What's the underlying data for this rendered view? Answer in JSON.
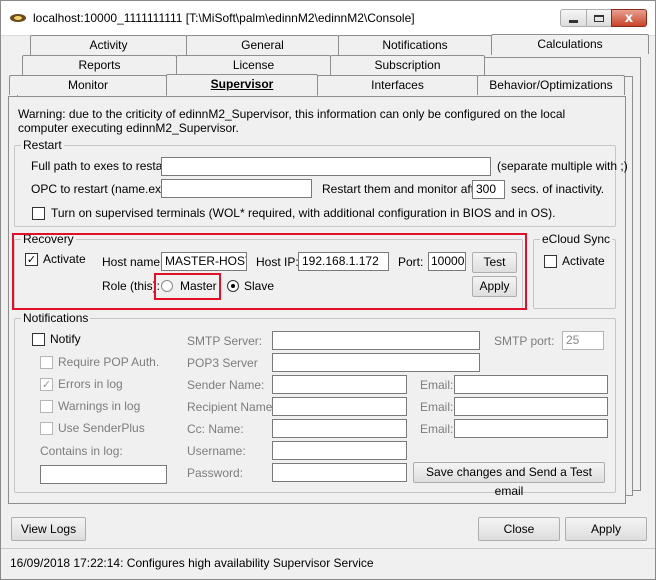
{
  "window": {
    "title": "localhost:10000_1111111111 [T:\\MiSoft\\palm\\edinnM2\\edinnM2\\Console]",
    "close_glyph": "x",
    "icons": [
      "app-icon",
      "minimize-icon",
      "maximize-icon",
      "close-icon"
    ]
  },
  "tabs": {
    "row1": [
      "Activity",
      "General",
      "Notifications",
      "Calculations"
    ],
    "row2": [
      "Reports",
      "License",
      "Subscription"
    ],
    "row3": [
      "Monitor",
      "Supervisor",
      "Interfaces",
      "Behavior/Optimizations"
    ],
    "active": "Supervisor"
  },
  "warning": "Warning: due to the criticity of edinnM2_Supervisor, this information can only be configured on the local computer executing edinnM2_Supervisor.",
  "restart": {
    "legend": "Restart",
    "exes_label": "Full path to exes to restart:",
    "exes_value": "",
    "exes_hint": "(separate multiple with ;)",
    "opc_label": "OPC to restart (name.exe):",
    "opc_value": "",
    "monitor_label": "Restart them and monitor after:",
    "monitor_value": "300",
    "monitor_suffix": "secs. of inactivity.",
    "wol_label": "Turn on supervised terminals (WOL* required, with additional configuration in BIOS and in OS).",
    "wol_checked": false
  },
  "recovery": {
    "legend": "Recovery",
    "activate_label": "Activate",
    "activate_checked": true,
    "check_glyph": "✓",
    "host_name_label": "Host name:",
    "host_name_value": "MASTER-HOST",
    "host_ip_label": "Host IP:",
    "host_ip_value": "192.168.1.172",
    "port_label": "Port:",
    "port_value": "10000",
    "test_label": "Test",
    "role_label": "Role (this):",
    "master_label": "Master",
    "slave_label": "Slave",
    "selected_role": "Slave",
    "apply_label": "Apply"
  },
  "ecloud": {
    "legend": "eCloud Sync",
    "activate_label": "Activate",
    "activate_checked": false
  },
  "notifications": {
    "legend": "Notifications",
    "notify_label": "Notify",
    "notify_checked": false,
    "require_pop_label": "Require POP Auth.",
    "errors_label": "Errors in log",
    "errors_checked": true,
    "warnings_label": "Warnings in log",
    "sender_plus_label": "Use SenderPlus",
    "contains_label": "Contains in log:",
    "contains_value": "",
    "smtp_server_label": "SMTP Server:",
    "smtp_server_value": "",
    "smtp_port_label": "SMTP port:",
    "smtp_port_value": "25",
    "pop3_label": "POP3 Server",
    "pop3_value": "",
    "sender_name_label": "Sender Name:",
    "sender_name_value": "",
    "recipient_name_label": "Recipient Name:",
    "recipient_name_value": "",
    "cc_name_label": "Cc: Name:",
    "cc_name_value": "",
    "username_label": "Username:",
    "username_value": "",
    "password_label": "Password:",
    "password_value": "",
    "email_label": "Email:",
    "email1_value": "",
    "email2_value": "",
    "email3_value": "",
    "save_send_label": "Save changes and Send a Test email"
  },
  "footer": {
    "view_logs_label": "View Logs",
    "close_label": "Close",
    "apply_label": "Apply"
  },
  "status": "16/09/2018 17:22:14: Configures high availability Supervisor Service",
  "colors": {
    "highlight": "#e0102a",
    "close_button": "#c7432a"
  }
}
